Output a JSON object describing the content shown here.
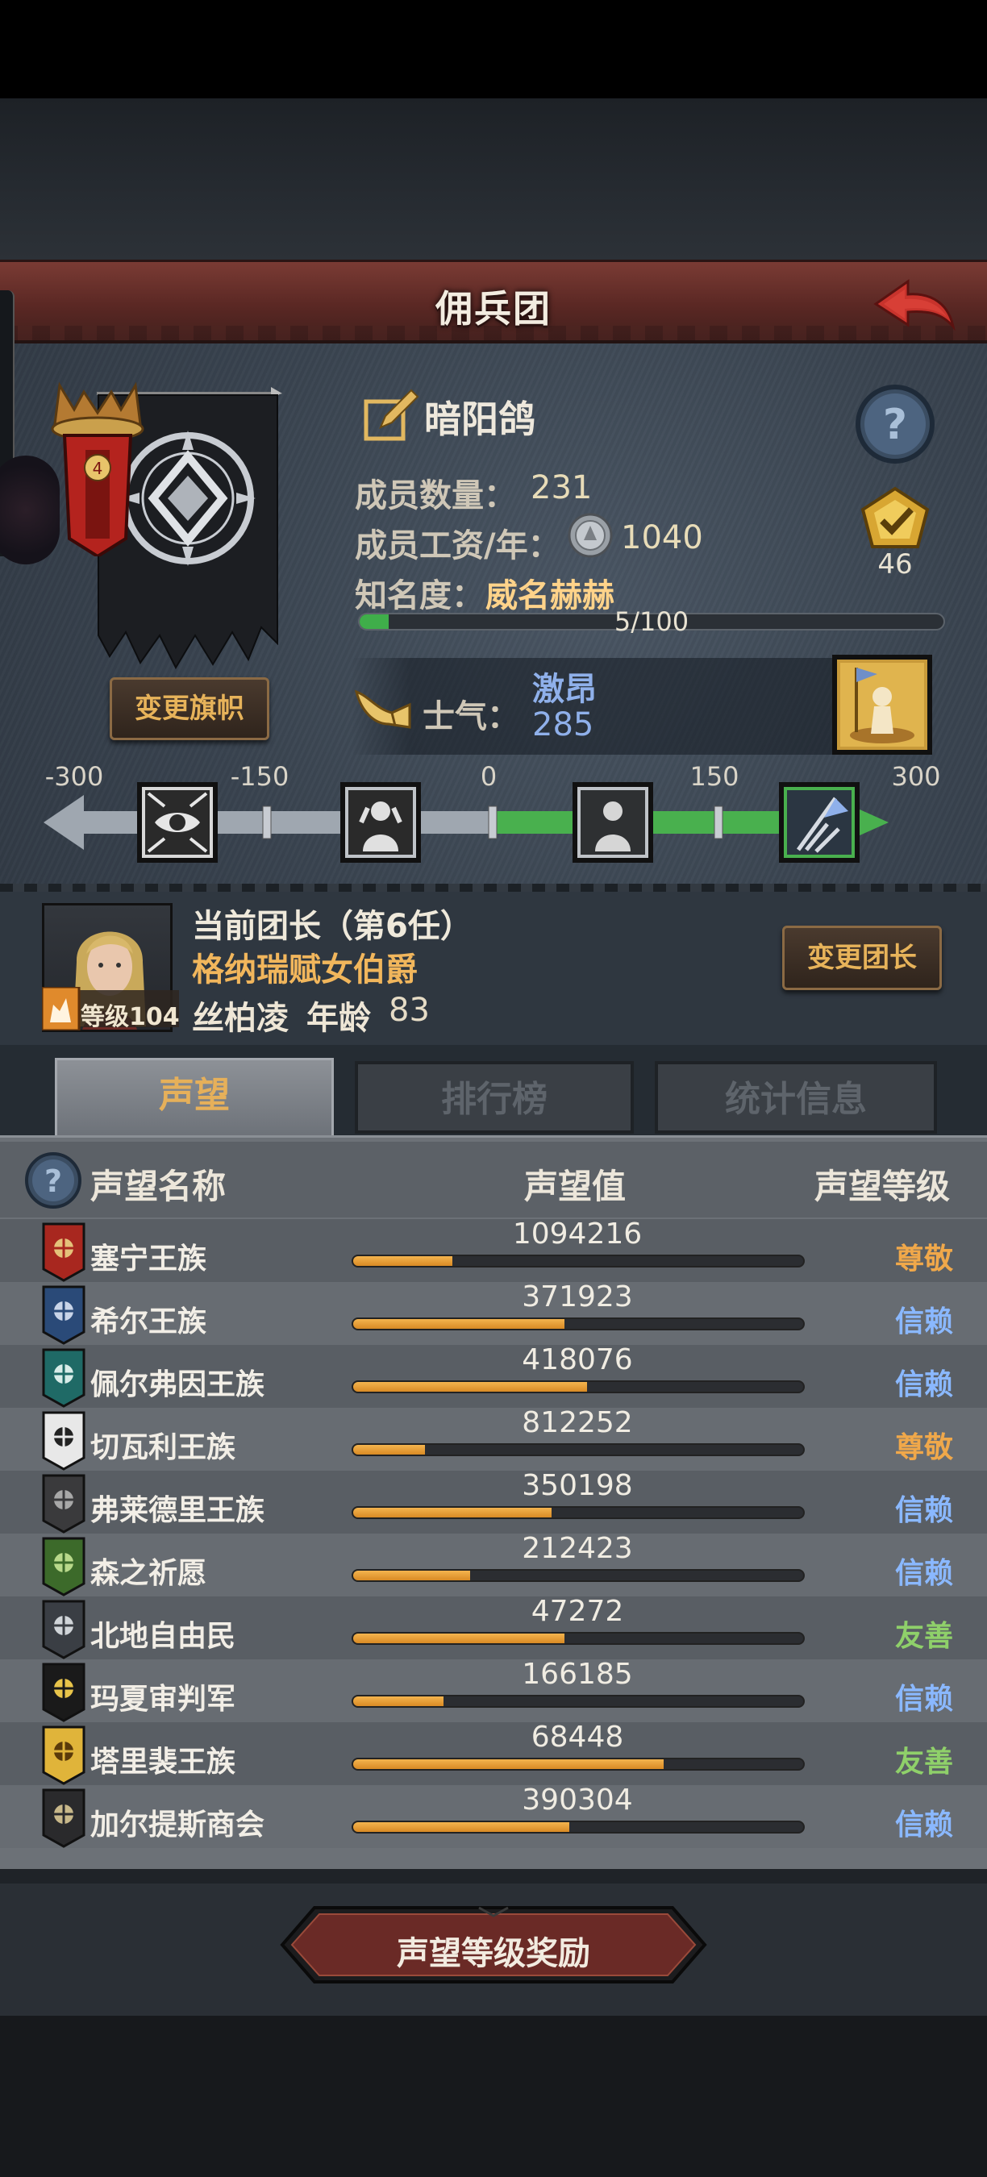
{
  "header": {
    "title": "佣兵团"
  },
  "banner": {
    "change_label": "变更旗帜"
  },
  "corps": {
    "name": "暗阳鸽",
    "member_count_label": "成员数量：",
    "member_count": "231",
    "salary_label": "成员工资/年：",
    "salary": "1040",
    "fame_label": "知名度：",
    "fame_title": "威名赫赫",
    "fame_progress_text": "5/100",
    "fame_progress": 0.05,
    "rank": "46"
  },
  "morale": {
    "label": "士气：",
    "status": "激昂",
    "value": "285",
    "scale_ticks": [
      "-300",
      "-150",
      "0",
      "150",
      "300"
    ]
  },
  "commander": {
    "title": "当前团长（第6任）",
    "name": "格纳瑞赋女伯爵",
    "trait": "丝柏凌",
    "age_label": "年龄",
    "age": "83",
    "level": "等级104",
    "change_label": "变更团长"
  },
  "tabs": [
    {
      "label": "声望",
      "active": true
    },
    {
      "label": "排行榜",
      "active": false
    },
    {
      "label": "统计信息",
      "active": false
    }
  ],
  "reputation": {
    "col_name": "声望名称",
    "col_value": "声望值",
    "col_level": "声望等级",
    "rows": [
      {
        "name": "塞宁王族",
        "value": "1094216",
        "fill": 0.22,
        "level": "尊敬",
        "level_color": "#f0a84a",
        "emblem": "red-crest-icon"
      },
      {
        "name": "希尔王族",
        "value": "371923",
        "fill": 0.47,
        "level": "信赖",
        "level_color": "#8ab8ff",
        "emblem": "blue-skull-icon"
      },
      {
        "name": "佩尔弗因王族",
        "value": "418076",
        "fill": 0.52,
        "level": "信赖",
        "level_color": "#8ab8ff",
        "emblem": "teal-shield-icon"
      },
      {
        "name": "切瓦利王族",
        "value": "812252",
        "fill": 0.16,
        "level": "尊敬",
        "level_color": "#f0a84a",
        "emblem": "scales-icon"
      },
      {
        "name": "弗莱德里王族",
        "value": "350198",
        "fill": 0.44,
        "level": "信赖",
        "level_color": "#8ab8ff",
        "emblem": "dark-mask-icon"
      },
      {
        "name": "森之祈愿",
        "value": "212423",
        "fill": 0.26,
        "level": "信赖",
        "level_color": "#8ab8ff",
        "emblem": "tree-icon"
      },
      {
        "name": "北地自由民",
        "value": "47272",
        "fill": 0.47,
        "level": "友善",
        "level_color": "#8fd06a",
        "emblem": "axe-icon"
      },
      {
        "name": "玛夏审判军",
        "value": "166185",
        "fill": 0.2,
        "level": "信赖",
        "level_color": "#8ab8ff",
        "emblem": "gold-cross-icon"
      },
      {
        "name": "塔里裴王族",
        "value": "68448",
        "fill": 0.69,
        "level": "友善",
        "level_color": "#8fd06a",
        "emblem": "gold-crown-icon"
      },
      {
        "name": "加尔提斯商会",
        "value": "390304",
        "fill": 0.48,
        "level": "信赖",
        "level_color": "#8ab8ff",
        "emblem": "chest-icon"
      }
    ]
  },
  "footer": {
    "reward_label": "声望等级奖励"
  }
}
